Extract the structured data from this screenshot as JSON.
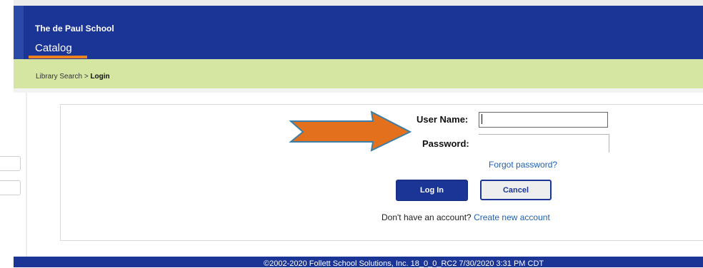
{
  "header": {
    "school_name": "The de Paul School",
    "tab_label": "Catalog",
    "brand_color": "#1b3596",
    "accent_color": "#f0821e"
  },
  "breadcrumb": {
    "parent": "Library Search",
    "separator": ">",
    "current": "Login",
    "bar_color": "#d5e6a3"
  },
  "login": {
    "username_label": "User Name:",
    "username_value": "",
    "password_label": "Password:",
    "password_value": "",
    "forgot_link": "Forgot password?",
    "login_button": "Log In",
    "cancel_button": "Cancel",
    "no_account_text": "Don't have an account?",
    "create_account_link": "Create new account"
  },
  "annotation": {
    "arrow_icon": "orange-right-arrow-icon",
    "arrow_color": "#e2701d"
  },
  "footer": {
    "text": "©2002-2020 Follett School Solutions, Inc.   18_0_0_RC2   7/30/2020 3:31 PM CDT"
  }
}
